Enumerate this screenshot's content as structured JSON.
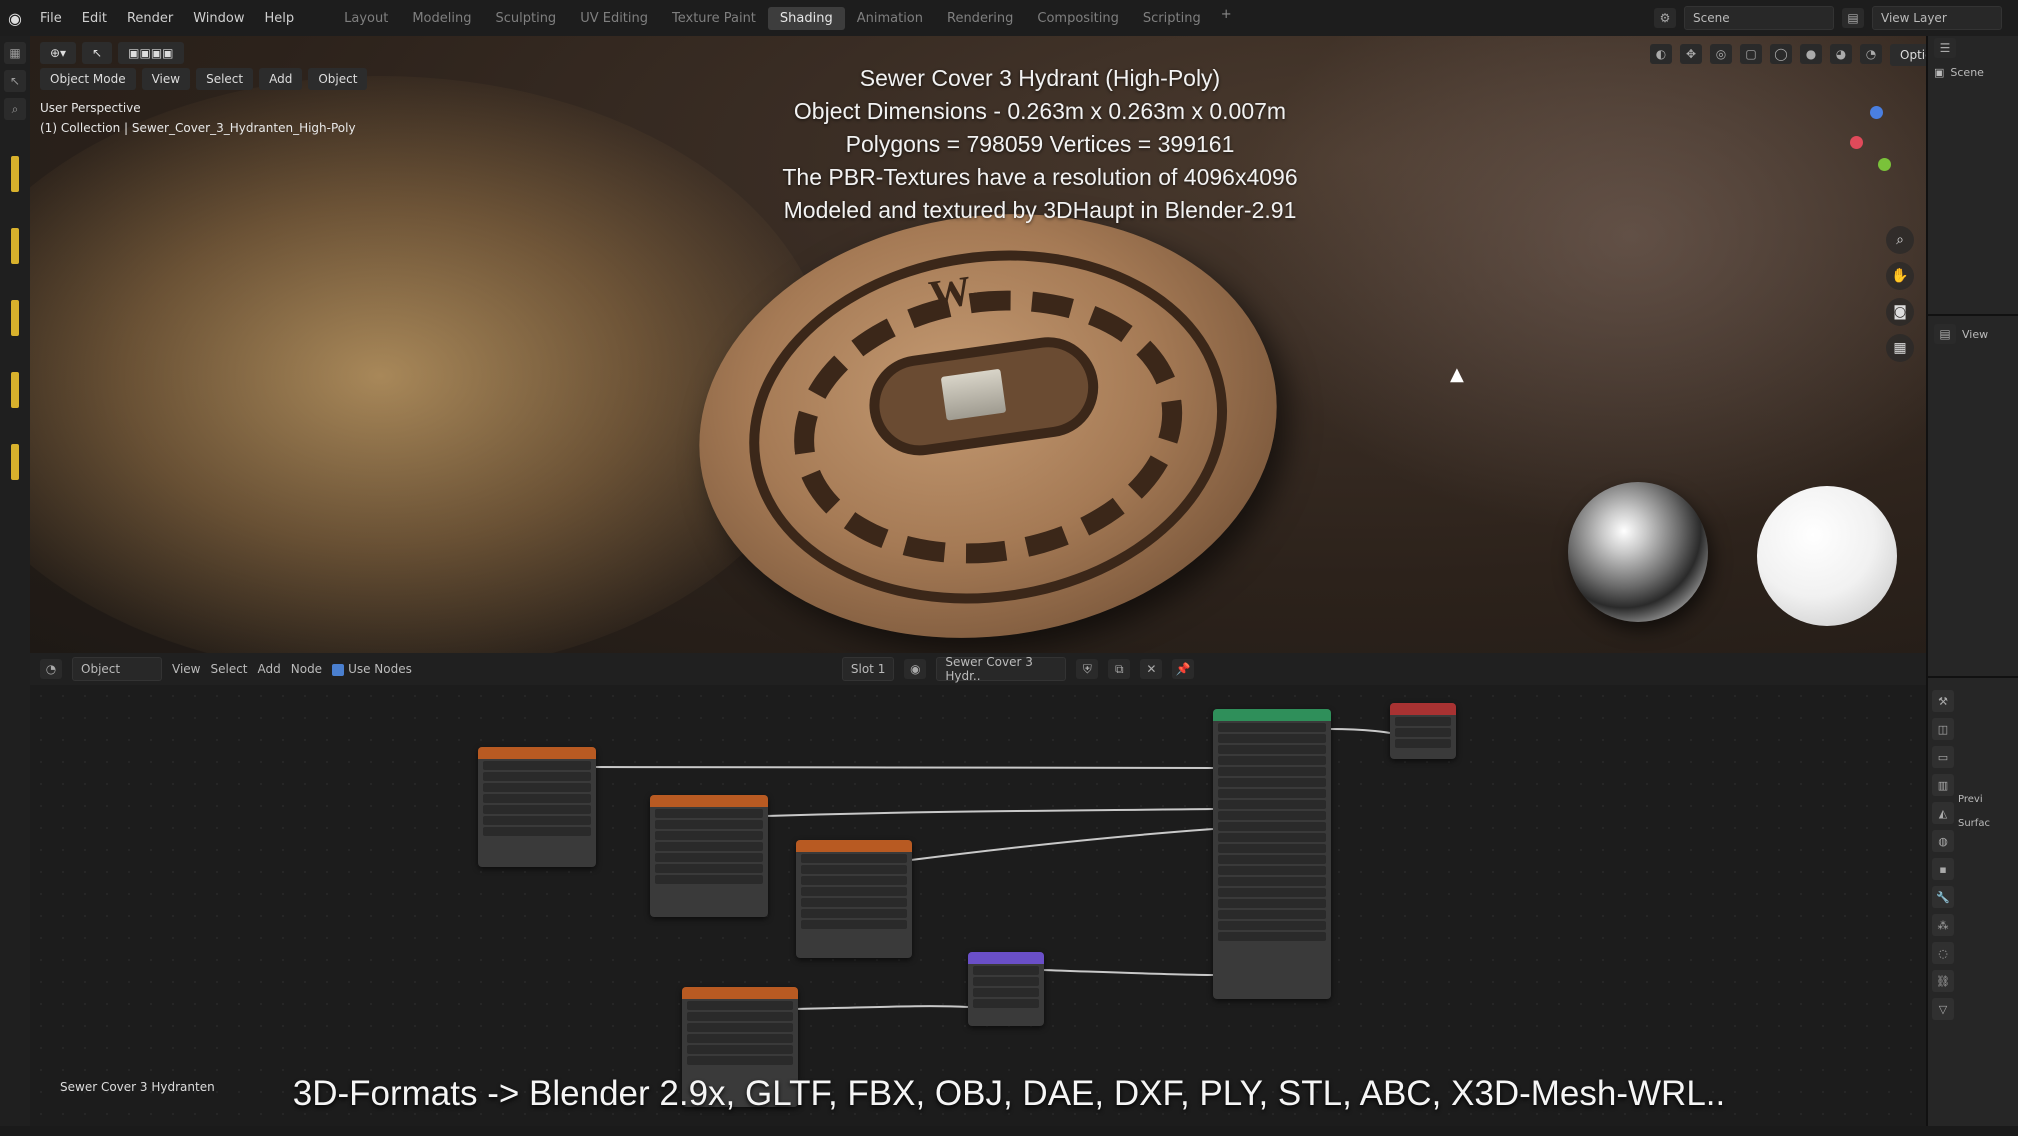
{
  "menu": [
    "File",
    "Edit",
    "Render",
    "Window",
    "Help"
  ],
  "workspace_tabs": [
    "Layout",
    "Modeling",
    "Sculpting",
    "UV Editing",
    "Texture Paint",
    "Shading",
    "Animation",
    "Rendering",
    "Compositing",
    "Scripting"
  ],
  "active_tab": "Shading",
  "scene_field": "Scene",
  "view_layer_field": "View Layer",
  "viewport": {
    "mode": "Object Mode",
    "menu": [
      "View",
      "Select",
      "Add",
      "Object"
    ],
    "perspective_label": "User Perspective",
    "collection_label": "(1) Collection | Sewer_Cover_3_Hydranten_High-Poly",
    "options_label": "Options"
  },
  "overlay": {
    "line1": "Sewer Cover 3 Hydrant (High-Poly)",
    "line2": "Object Dimensions - 0.263m x 0.263m x 0.007m",
    "line3": "Polygons = 798059  Vertices = 399161",
    "line4": "The PBR-Textures have a resolution of 4096x4096",
    "line5": "Modeled and textured by 3DHaupt in Blender-2.91"
  },
  "outliner": {
    "scene_label": "Scene"
  },
  "properties": {
    "view_label": "View",
    "preview_label": "Previ",
    "surface_label": "Surfac"
  },
  "node_editor": {
    "object_dropdown": "Object",
    "menu": [
      "View",
      "Select",
      "Add",
      "Node"
    ],
    "use_nodes_label": "Use Nodes",
    "slot_label": "Slot 1",
    "material_name": "Sewer Cover 3 Hydr..",
    "bottom_label": "Sewer Cover 3 Hydranten"
  },
  "footer": "3D-Formats -> Blender 2.9x, GLTF, FBX, OBJ, DAE, DXF, PLY, STL, ABC, X3D-Mesh-WRL..",
  "colors": {
    "accent": "#4a7fcf",
    "active_object": "#d8b12c",
    "shader_node": "#2f8f5a",
    "output_node": "#a83232",
    "image_node": "#b85a22"
  }
}
